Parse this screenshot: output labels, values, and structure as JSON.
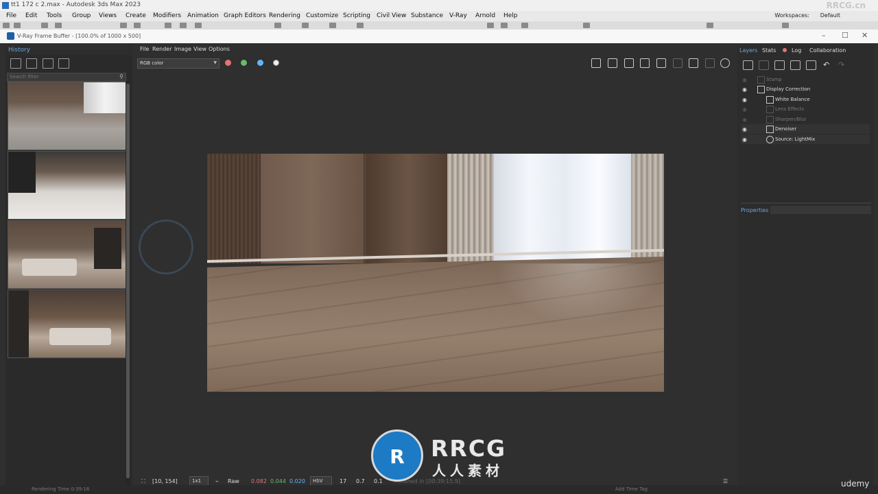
{
  "max_window": {
    "title": "tt1 172 c 2.max - Autodesk 3ds Max 2023",
    "watermark": "RRCG.cn",
    "menu": [
      "File",
      "Edit",
      "Tools",
      "Group",
      "Views",
      "Create",
      "Modifiers",
      "Animation",
      "Graph Editors",
      "Rendering",
      "Customize",
      "Scripting",
      "Civil View",
      "Substance",
      "V-Ray",
      "Arnold",
      "Help"
    ],
    "workspaces_label": "Workspaces:",
    "workspaces_value": "Default"
  },
  "vfb": {
    "title": "V-Ray Frame Buffer - [100.0% of 1000 x 500]",
    "menu": [
      "File",
      "Render",
      "Image",
      "View",
      "Options"
    ],
    "channel": "RGB color",
    "history": {
      "tab": "History",
      "search_placeholder": "Search filter"
    },
    "right_tabs": [
      "Layers",
      "Stats",
      "Log",
      "Collaboration"
    ],
    "layers": [
      {
        "label": "Stamp",
        "enabled": false
      },
      {
        "label": "Display Correction",
        "enabled": true
      },
      {
        "label": "White Balance",
        "enabled": true
      },
      {
        "label": "Lens Effects",
        "enabled": false
      },
      {
        "label": "Sharpen/Blur",
        "enabled": false
      },
      {
        "label": "Denoiser",
        "enabled": true
      },
      {
        "label": "Source: LightMix",
        "enabled": true
      }
    ],
    "properties_label": "Properties",
    "status": {
      "coords": "[10, 154]",
      "zoom": "1x1",
      "mode": "Raw",
      "r": "0.082",
      "g": "0.044",
      "b": "0.020",
      "color_space": "HSV",
      "v1": "17",
      "v2": "0.7",
      "v3": "0.1",
      "finished": "Finished in [00:39:15.9]"
    },
    "bottom": {
      "rendering_time": "Rendering Time 0:39:16",
      "add_time_tag": "Add Time Tag"
    }
  },
  "watermark": {
    "logo_text": "RRCG",
    "sub_text": "人人素材",
    "badge": "udemy"
  },
  "colors": {
    "accent_blue": "#6aa7e0",
    "red_channel": "#e57373",
    "green_channel": "#66bb6a",
    "blue_channel": "#64b5f6"
  }
}
